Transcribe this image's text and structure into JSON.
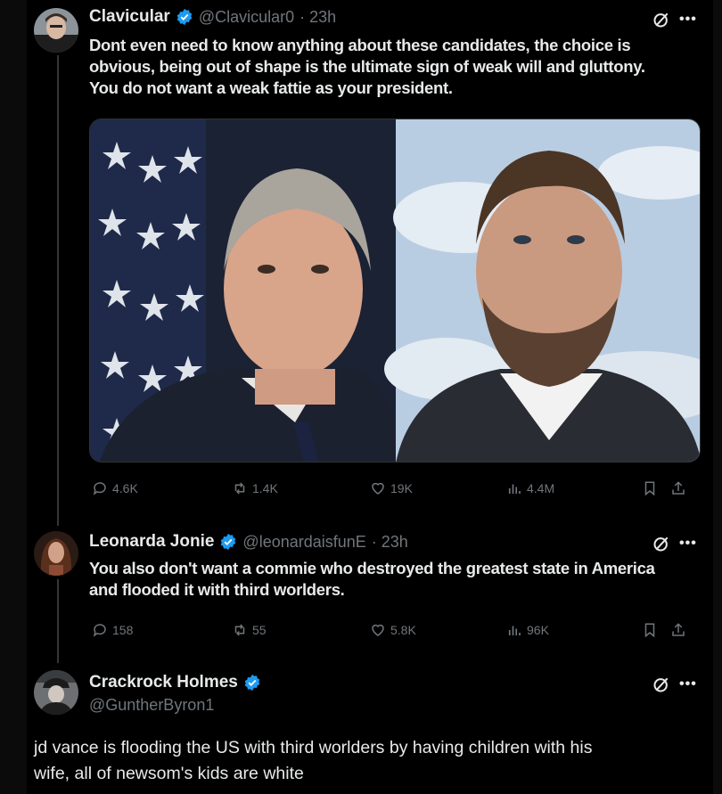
{
  "tweets": [
    {
      "name": "Clavicular",
      "handle": "@Clavicular0",
      "time": "· 23h",
      "text_lines": [
        "Dont even need to know anything about these candidates, the choice is",
        "obvious, being out of shape is the ultimate sign of weak will and gluttony.",
        "You do not want a weak fattie as your president."
      ],
      "stats": {
        "replies": "4.6K",
        "reposts": "1.4K",
        "likes": "19K",
        "views": "4.4M"
      }
    },
    {
      "name": "Leonarda Jonie",
      "handle": "@leonardaisfunE",
      "time": "· 23h",
      "text_lines": [
        "You also don't want a commie who destroyed the greatest state in America",
        "and flooded it with third worlders."
      ],
      "stats": {
        "replies": "158",
        "reposts": "55",
        "likes": "5.8K",
        "views": "96K"
      }
    },
    {
      "name": "Crackrock Holmes",
      "handle": "@GuntherByron1",
      "text_lines": [
        "jd vance is flooding the US with third worlders by having children with his",
        "wife, all of newsom's kids are white"
      ]
    }
  ],
  "icons": {
    "verified": "verified-badge-icon",
    "grok": "grok-icon",
    "more": "more-icon",
    "reply": "reply-icon",
    "repost": "repost-icon",
    "like": "heart-icon",
    "views": "views-icon",
    "bookmark": "bookmark-icon",
    "share": "share-icon"
  },
  "colors": {
    "background": "#000000",
    "text": "#e7e9ea",
    "muted": "#71767b",
    "verified": "#1d9bf0",
    "divider": "#333639"
  }
}
